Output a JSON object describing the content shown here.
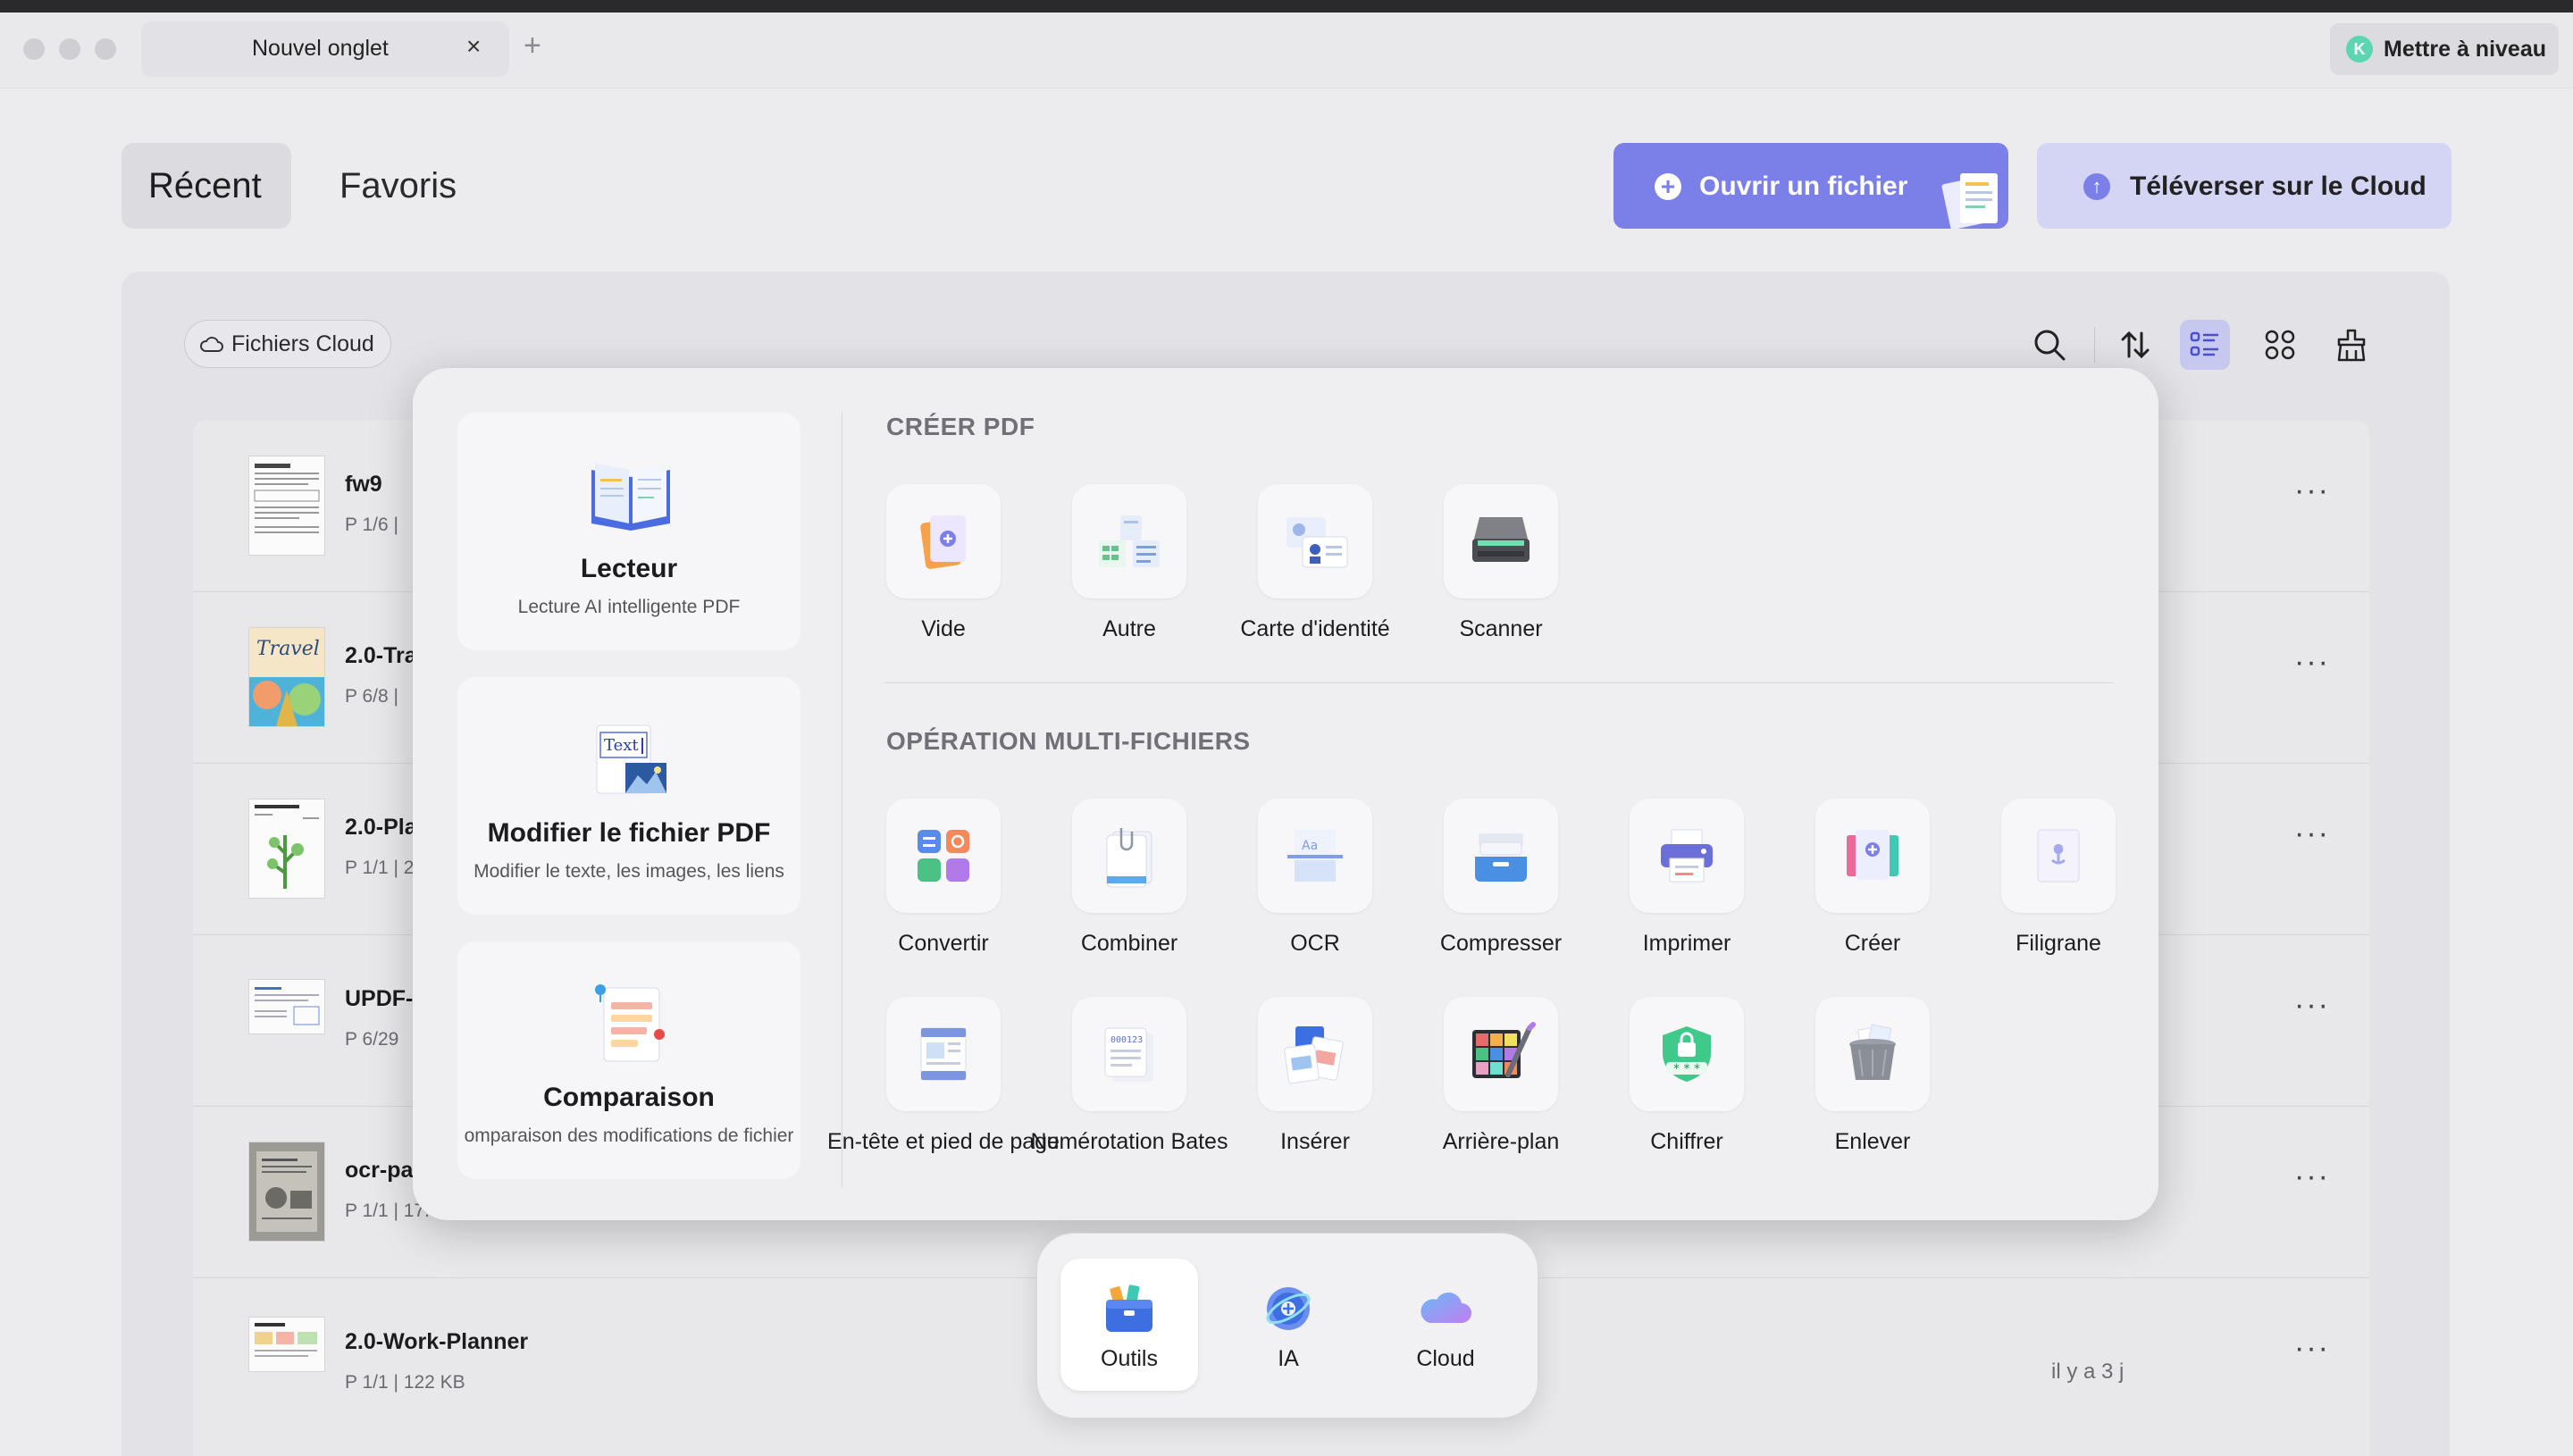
{
  "titlebar": {
    "tab_label": "Nouvel onglet",
    "tab_close": "×",
    "tab_add": "+",
    "upgrade_avatar": "K",
    "upgrade_label": "Mettre à niveau"
  },
  "header": {
    "tabs": [
      {
        "label": "Récent",
        "active": true
      },
      {
        "label": "Favoris",
        "active": false
      }
    ],
    "open_file_label": "Ouvrir un fichier",
    "upload_label": "Téléverser sur le Cloud"
  },
  "toolbar": {
    "cloud_chip_label": "Fichiers Cloud",
    "icons": [
      "search-icon",
      "sort-icon",
      "list-view-icon",
      "grid-view-icon",
      "clear-icon"
    ]
  },
  "files": [
    {
      "name": "fw9",
      "meta": "P 1/6  |"
    },
    {
      "name": "2.0-Tra",
      "meta": "P 6/8  |"
    },
    {
      "name": "2.0-Pla",
      "meta": "P 1/1  |  2"
    },
    {
      "name": "UPDF-",
      "meta": "P 6/29"
    },
    {
      "name": "ocr-pa",
      "meta": "P 1/1  |  17."
    },
    {
      "name": "2.0-Work-Planner",
      "meta": "P 1/1  |  122 KB",
      "time": "il y a 3 j"
    }
  ],
  "more_glyph": "···",
  "popover": {
    "left_cards": [
      {
        "title": "Lecteur",
        "subtitle": "Lecture AI intelligente PDF"
      },
      {
        "title": "Modifier le fichier PDF",
        "subtitle": "Modifier le texte, les images, les liens"
      },
      {
        "title": "Comparaison",
        "subtitle": "omparaison des modifications de fichier"
      }
    ],
    "sections": [
      {
        "title": "CRÉER PDF",
        "tools": [
          {
            "label": "Vide",
            "icon": "blank-page-icon"
          },
          {
            "label": "Autre",
            "icon": "other-format-icon"
          },
          {
            "label": "Carte d'identité",
            "icon": "id-card-icon"
          },
          {
            "label": "Scanner",
            "icon": "scanner-icon"
          }
        ]
      },
      {
        "title": "OPÉRATION MULTI-FICHIERS",
        "tools": [
          {
            "label": "Convertir",
            "icon": "convert-icon"
          },
          {
            "label": "Combiner",
            "icon": "combine-icon"
          },
          {
            "label": "OCR",
            "icon": "ocr-icon"
          },
          {
            "label": "Compresser",
            "icon": "compress-icon"
          },
          {
            "label": "Imprimer",
            "icon": "print-icon"
          },
          {
            "label": "Créer",
            "icon": "create-icon"
          },
          {
            "label": "Filigrane",
            "icon": "watermark-icon"
          },
          {
            "label": "En-tête et pied de page",
            "icon": "header-footer-icon"
          },
          {
            "label": "Numérotation Bates",
            "icon": "bates-numbering-icon"
          },
          {
            "label": "Insérer",
            "icon": "insert-icon"
          },
          {
            "label": "Arrière-plan",
            "icon": "background-icon"
          },
          {
            "label": "Chiffrer",
            "icon": "encrypt-icon"
          },
          {
            "label": "Enlever",
            "icon": "remove-icon"
          }
        ]
      }
    ]
  },
  "dock": {
    "items": [
      {
        "label": "Outils",
        "active": true
      },
      {
        "label": "IA",
        "active": false
      },
      {
        "label": "Cloud",
        "active": false
      }
    ]
  },
  "colors": {
    "accent": "#7b7fe8",
    "accent_light": "#d4d4f4",
    "avatar": "#5bd6b0"
  }
}
